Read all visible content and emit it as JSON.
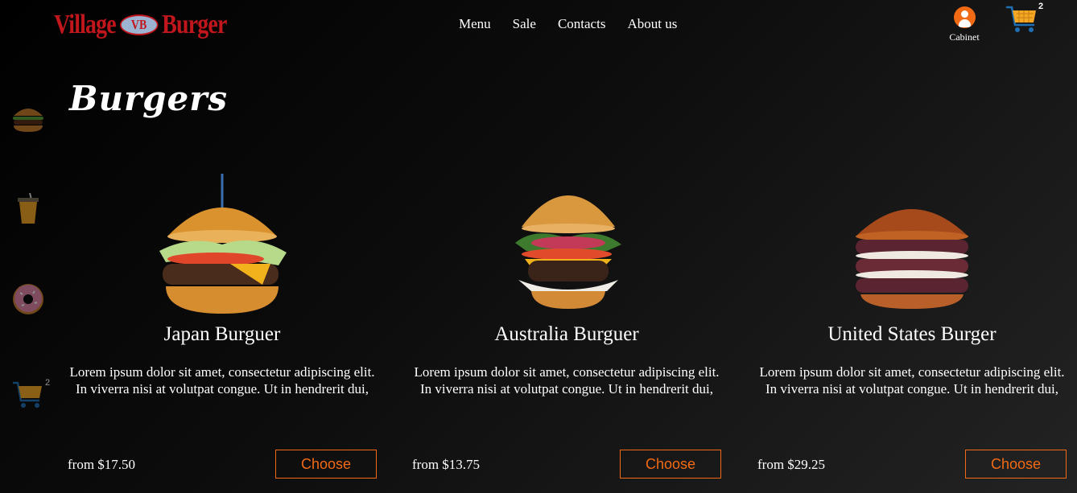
{
  "brand": {
    "left": "Village",
    "badge": "VB",
    "right": "Burger"
  },
  "nav": [
    "Menu",
    "Sale",
    "Contacts",
    "About us"
  ],
  "cabinet": {
    "label": "Cabinet"
  },
  "cart": {
    "count": "2"
  },
  "sidebar": {
    "items": [
      "burger-icon",
      "drink-icon",
      "donut-icon",
      "cart-icon"
    ],
    "cart_count": "2"
  },
  "page_title": "Burgers",
  "products": [
    {
      "name": "Japan Burguer",
      "description": "Lorem ipsum dolor sit amet, consectetur adipiscing elit. In viverra nisi at volutpat congue. Ut in hendrerit dui,",
      "price": "from $17.50",
      "button": "Choose"
    },
    {
      "name": "Australia Burguer",
      "description": "Lorem ipsum dolor sit amet, consectetur adipiscing elit. In viverra nisi at volutpat congue. Ut in hendrerit dui,",
      "price": "from $13.75",
      "button": "Choose"
    },
    {
      "name": "United States Burger",
      "description": "Lorem ipsum dolor sit amet, consectetur adipiscing elit. In viverra nisi at volutpat congue. Ut in hendrerit dui,",
      "price": "from $29.25",
      "button": "Choose"
    }
  ],
  "colors": {
    "accent": "#f26a14",
    "brand": "#c0161c",
    "cart": "#f5a623",
    "background": "#0d0d0d"
  }
}
